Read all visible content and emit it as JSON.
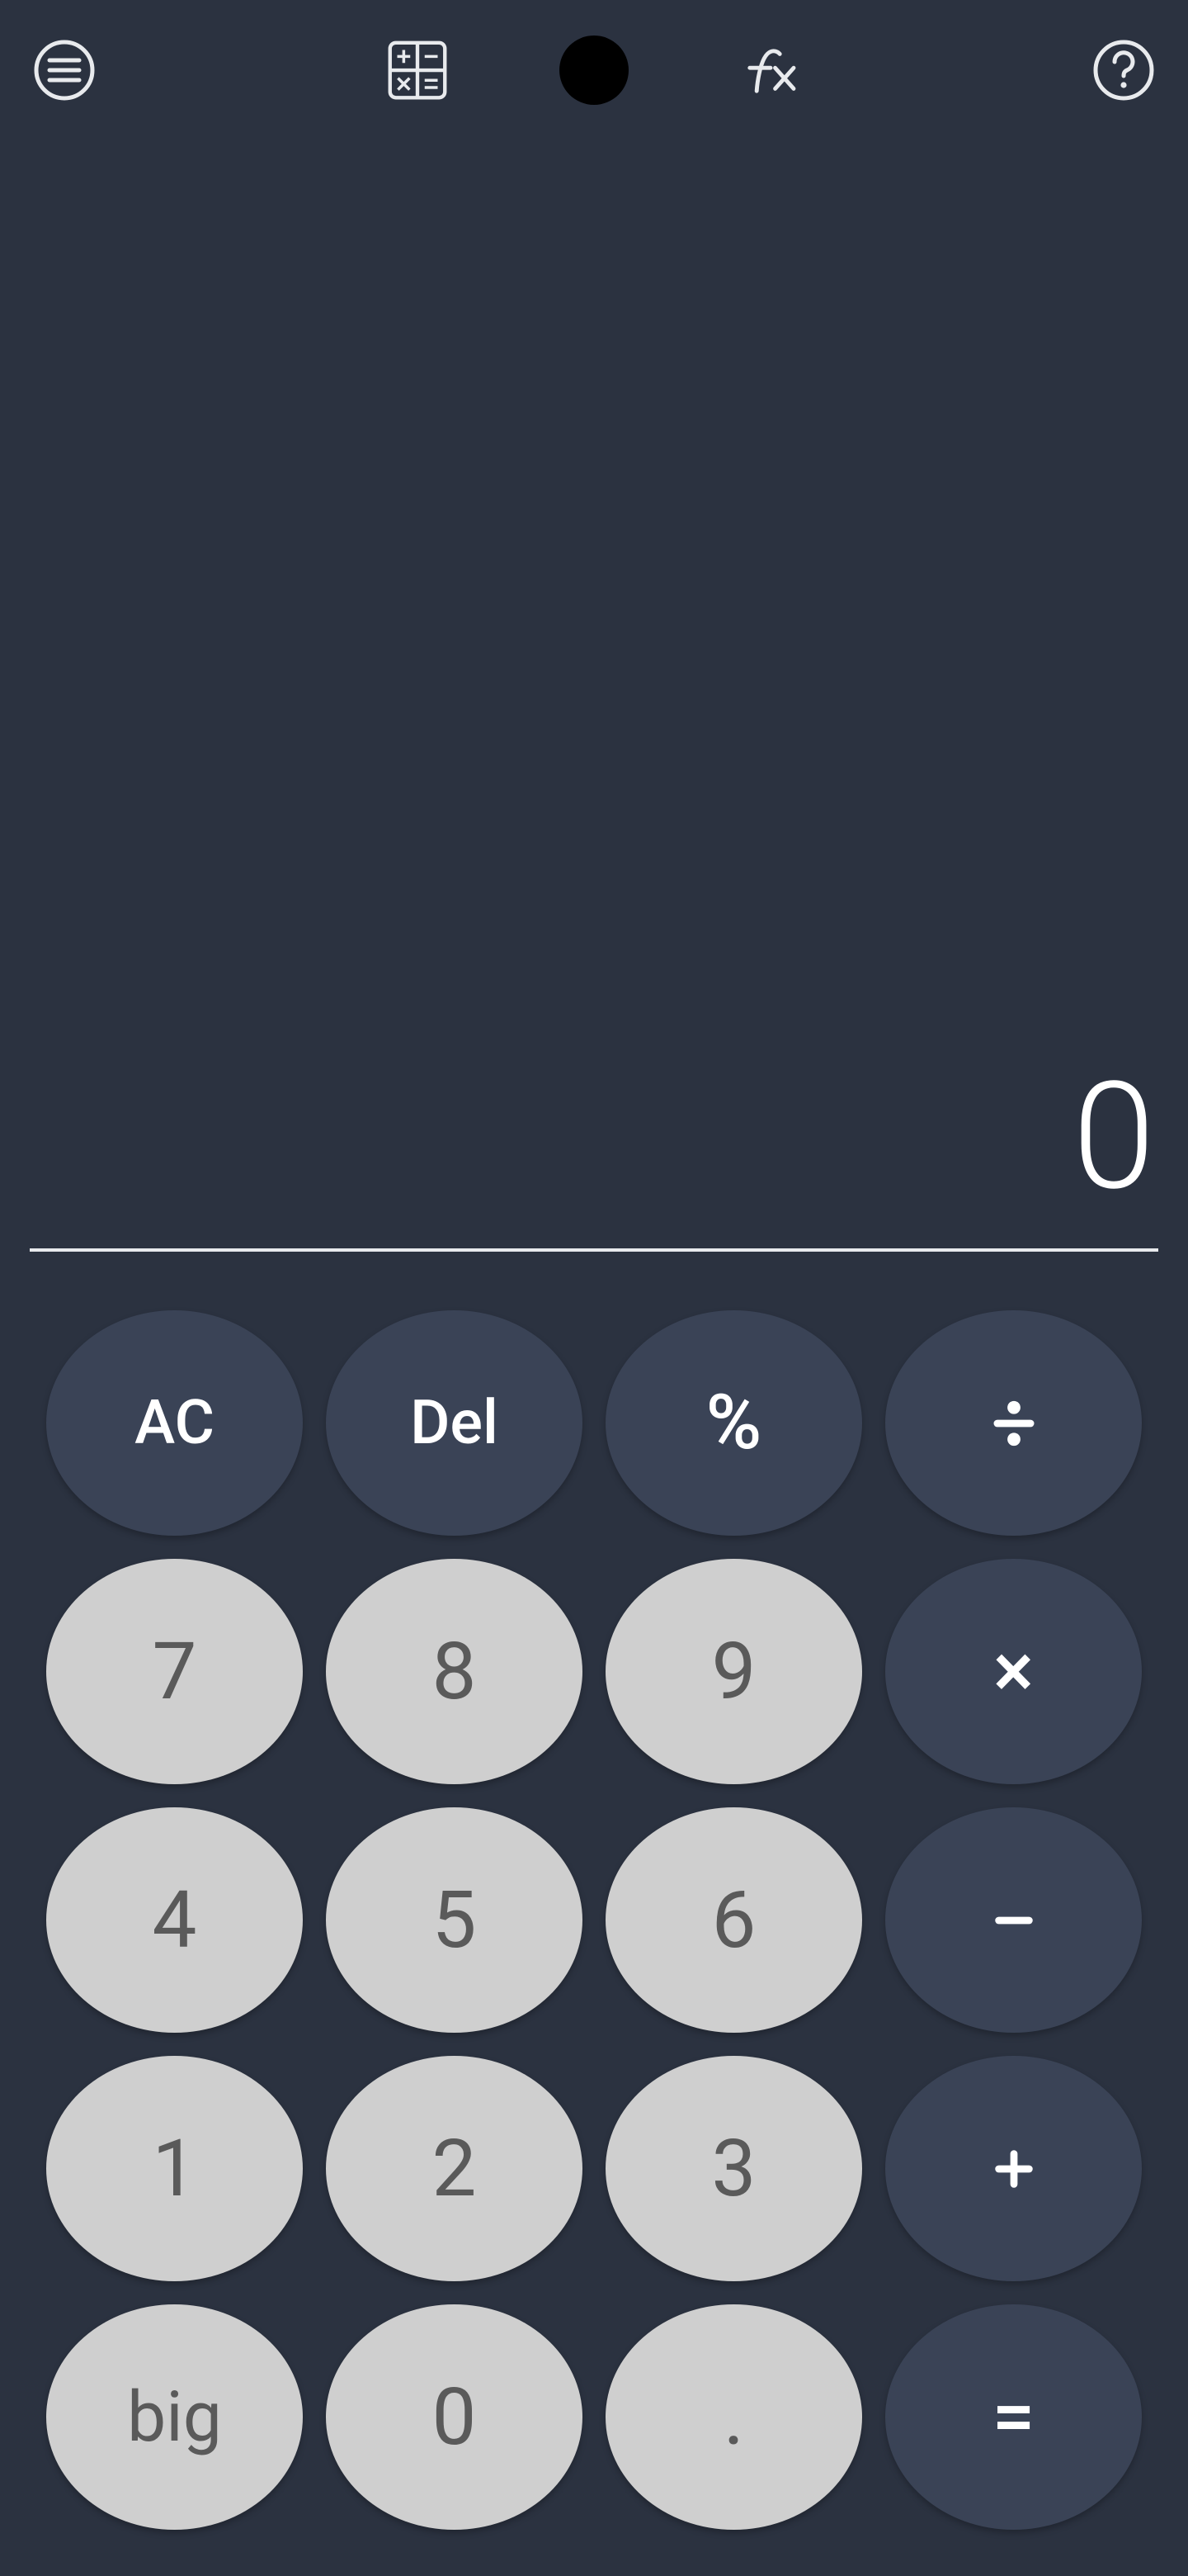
{
  "display": {
    "result": "0"
  },
  "keys": {
    "ac": "AC",
    "del": "Del",
    "percent": "%",
    "divide": "÷",
    "seven": "7",
    "eight": "8",
    "nine": "9",
    "multiply": "×",
    "four": "4",
    "five": "5",
    "six": "6",
    "minus": "−",
    "one": "1",
    "two": "2",
    "three": "3",
    "plus": "+",
    "big": "big",
    "zero": "0",
    "dot": ".",
    "equals": "="
  },
  "icons": {
    "menu": "menu-icon",
    "basic": "basic-calc-icon",
    "fx": "fx-icon",
    "help": "help-icon"
  }
}
